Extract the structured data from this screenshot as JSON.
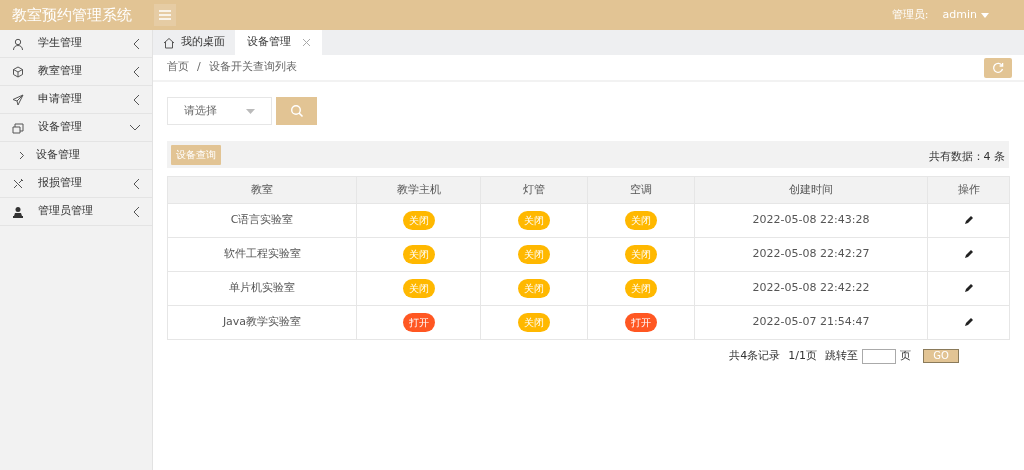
{
  "header": {
    "title": "教室预约管理系统",
    "user_label": "管理员:",
    "user_name": "admin"
  },
  "sidebar": {
    "items": [
      {
        "label": "学生管理",
        "expanded": false
      },
      {
        "label": "教室管理",
        "expanded": false
      },
      {
        "label": "申请管理",
        "expanded": false
      },
      {
        "label": "设备管理",
        "expanded": true,
        "children": [
          {
            "label": "设备管理"
          }
        ]
      },
      {
        "label": "报损管理",
        "expanded": false
      },
      {
        "label": "管理员管理",
        "expanded": false
      }
    ]
  },
  "tabs": [
    {
      "label": "我的桌面",
      "selected": false,
      "closable": false
    },
    {
      "label": "设备管理",
      "selected": true,
      "closable": true
    }
  ],
  "breadcrumb": {
    "items": [
      "首页",
      "设备开关查询列表"
    ],
    "separator": "/"
  },
  "search": {
    "placeholder": "请选择"
  },
  "toolbar": {
    "button": "设备查询",
    "total": "共有数据：4 条"
  },
  "table": {
    "columns": [
      "教室",
      "教学主机",
      "灯管",
      "空调",
      "创建时间",
      "操作"
    ],
    "rows": [
      {
        "room": "C语言实验室",
        "switches": [
          {
            "label": "关闭",
            "on": false
          },
          {
            "label": "关闭",
            "on": false
          },
          {
            "label": "关闭",
            "on": false
          }
        ],
        "created": "2022-05-08 22:43:28"
      },
      {
        "room": "软件工程实验室",
        "switches": [
          {
            "label": "关闭",
            "on": false
          },
          {
            "label": "关闭",
            "on": false
          },
          {
            "label": "关闭",
            "on": false
          }
        ],
        "created": "2022-05-08 22:42:27"
      },
      {
        "room": "单片机实验室",
        "switches": [
          {
            "label": "关闭",
            "on": false
          },
          {
            "label": "关闭",
            "on": false
          },
          {
            "label": "关闭",
            "on": false
          }
        ],
        "created": "2022-05-08 22:42:22"
      },
      {
        "room": "Java教学实验室",
        "switches": [
          {
            "label": "打开",
            "on": true
          },
          {
            "label": "关闭",
            "on": false
          },
          {
            "label": "打开",
            "on": true
          }
        ],
        "created": "2022-05-07 21:54:47"
      }
    ]
  },
  "pagination": {
    "records": "共4条记录",
    "pages": "1/1页",
    "jump_label": "跳转至",
    "page_unit": "页",
    "go": "GO"
  }
}
